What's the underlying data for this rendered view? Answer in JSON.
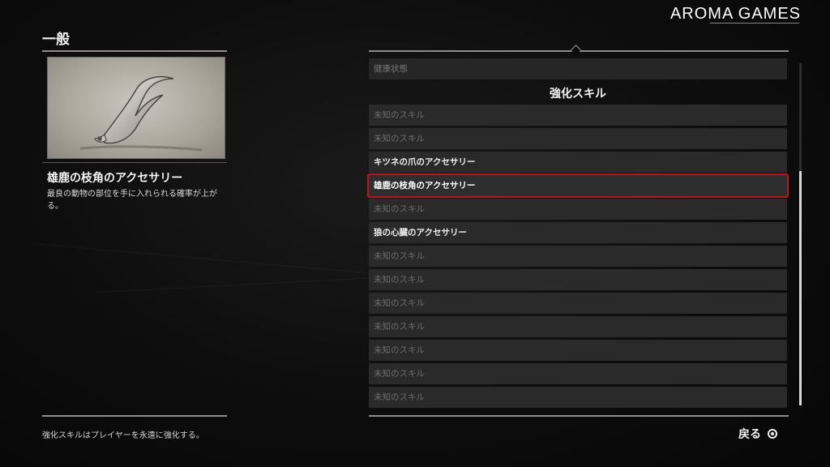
{
  "watermark": "AROMA GAMES",
  "section_title": "一般",
  "selected_item": {
    "name": "雄鹿の枝角のアクセサリー",
    "description": "最良の動物の部位を手に入れられる確率が上がる。",
    "image_icon": "antler-accessory-icon"
  },
  "footer_text": "強化スキルはプレイヤーを永遠に強化する。",
  "list": {
    "health_row": "健康状態",
    "heading": "強化スキル",
    "items": [
      {
        "label": "未知のスキル",
        "state": "unknown"
      },
      {
        "label": "未知のスキル",
        "state": "unknown"
      },
      {
        "label": "キツネの爪のアクセサリー",
        "state": "known"
      },
      {
        "label": "雄鹿の枝角のアクセサリー",
        "state": "selected"
      },
      {
        "label": "未知のスキル",
        "state": "unknown"
      },
      {
        "label": "狼の心臓のアクセサリー",
        "state": "known"
      },
      {
        "label": "未知のスキル",
        "state": "unknown"
      },
      {
        "label": "未知のスキル",
        "state": "unknown"
      },
      {
        "label": "未知のスキル",
        "state": "unknown"
      },
      {
        "label": "未知のスキル",
        "state": "unknown"
      },
      {
        "label": "未知のスキル",
        "state": "unknown"
      },
      {
        "label": "未知のスキル",
        "state": "unknown"
      },
      {
        "label": "未知のスキル",
        "state": "unknown"
      }
    ]
  },
  "back_button": {
    "label": "戻る",
    "icon": "circle-button-icon"
  },
  "colors": {
    "selection": "#c1121f",
    "row_bg": "#2a2a2a",
    "background": "#0d0d0d"
  }
}
